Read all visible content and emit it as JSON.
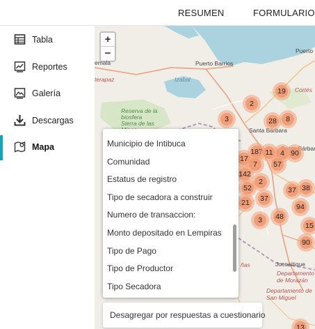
{
  "header": {
    "tabs": [
      {
        "label": "RESUMEN"
      },
      {
        "label": "FORMULARIO"
      }
    ]
  },
  "sidebar": {
    "items": [
      {
        "label": "Tabla",
        "icon": "table-icon"
      },
      {
        "label": "Reportes",
        "icon": "chart-icon"
      },
      {
        "label": "Galería",
        "icon": "gallery-icon"
      },
      {
        "label": "Descargas",
        "icon": "download-icon"
      },
      {
        "label": "Mapa",
        "icon": "map-icon",
        "active": true
      }
    ],
    "accent_color": "#17a2b8"
  },
  "map": {
    "zoom_in": "+",
    "zoom_out": "−",
    "place_labels": [
      "Puerto Barrios",
      "Puerto",
      "Izabal",
      "Cortés",
      "Santa Bárbara",
      "Santa Bárbara",
      "Reserva de la biosfera Sierra de las Minas",
      "emala",
      "terapaz",
      "Jocoaitique",
      "Departamento de Morazán",
      "Departamento de San Miguel",
      "ñas"
    ],
    "clusters": [
      "19",
      "2",
      "28",
      "8",
      "3",
      "187",
      "11",
      "4",
      "90",
      "17",
      "7",
      "57",
      "142",
      "2",
      "52",
      "21",
      "37",
      "37",
      "38",
      "94",
      "3",
      "48",
      "15",
      "90",
      "13"
    ],
    "cluster_color": "#f0966e"
  },
  "dropdown": {
    "options": [
      "Municipio de Intibuca",
      "Comunidad",
      "Estatus de registro",
      "Tipo de secadora a construir",
      "Numero de transaccion:",
      "Monto depositado en Lempiras",
      "Tipo de Pago",
      "Tipo de Productor",
      "Tipo Secadora"
    ]
  },
  "select": {
    "label": "Desagregar por respuestas a cuestionario"
  }
}
